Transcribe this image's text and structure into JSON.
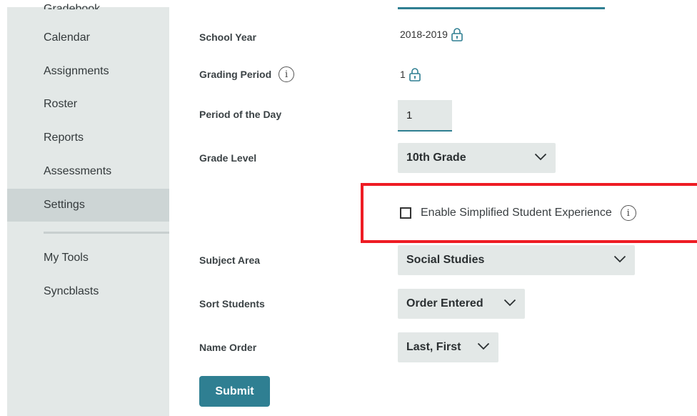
{
  "sidebar": {
    "items": [
      {
        "label": "Gradebook"
      },
      {
        "label": "Calendar"
      },
      {
        "label": "Assignments"
      },
      {
        "label": "Roster"
      },
      {
        "label": "Reports"
      },
      {
        "label": "Assessments"
      },
      {
        "label": "Settings",
        "active": true
      }
    ],
    "tools": [
      {
        "label": "My Tools"
      },
      {
        "label": "Syncblasts"
      }
    ]
  },
  "form": {
    "school_year": {
      "label": "School Year",
      "value": "2018-2019",
      "locked": true
    },
    "grading_period": {
      "label": "Grading Period",
      "value": "1",
      "locked": true,
      "info_icon": "info-icon"
    },
    "period_of_day": {
      "label": "Period of the Day",
      "value": "1"
    },
    "grade_level": {
      "label": "Grade Level",
      "value": "10th Grade"
    },
    "simplified": {
      "label": "Enable Simplified Student Experience",
      "checked": false,
      "info_icon": "info-icon"
    },
    "subject_area": {
      "label": "Subject Area",
      "value": "Social Studies"
    },
    "sort_students": {
      "label": "Sort Students",
      "value": "Order Entered"
    },
    "name_order": {
      "label": "Name Order",
      "value": "Last, First"
    },
    "submit_label": "Submit"
  },
  "colors": {
    "accent": "#2f7f92",
    "sidebar_bg": "#e3e8e7",
    "sidebar_active": "#cdd5d5",
    "highlight": "#ee1c24"
  }
}
